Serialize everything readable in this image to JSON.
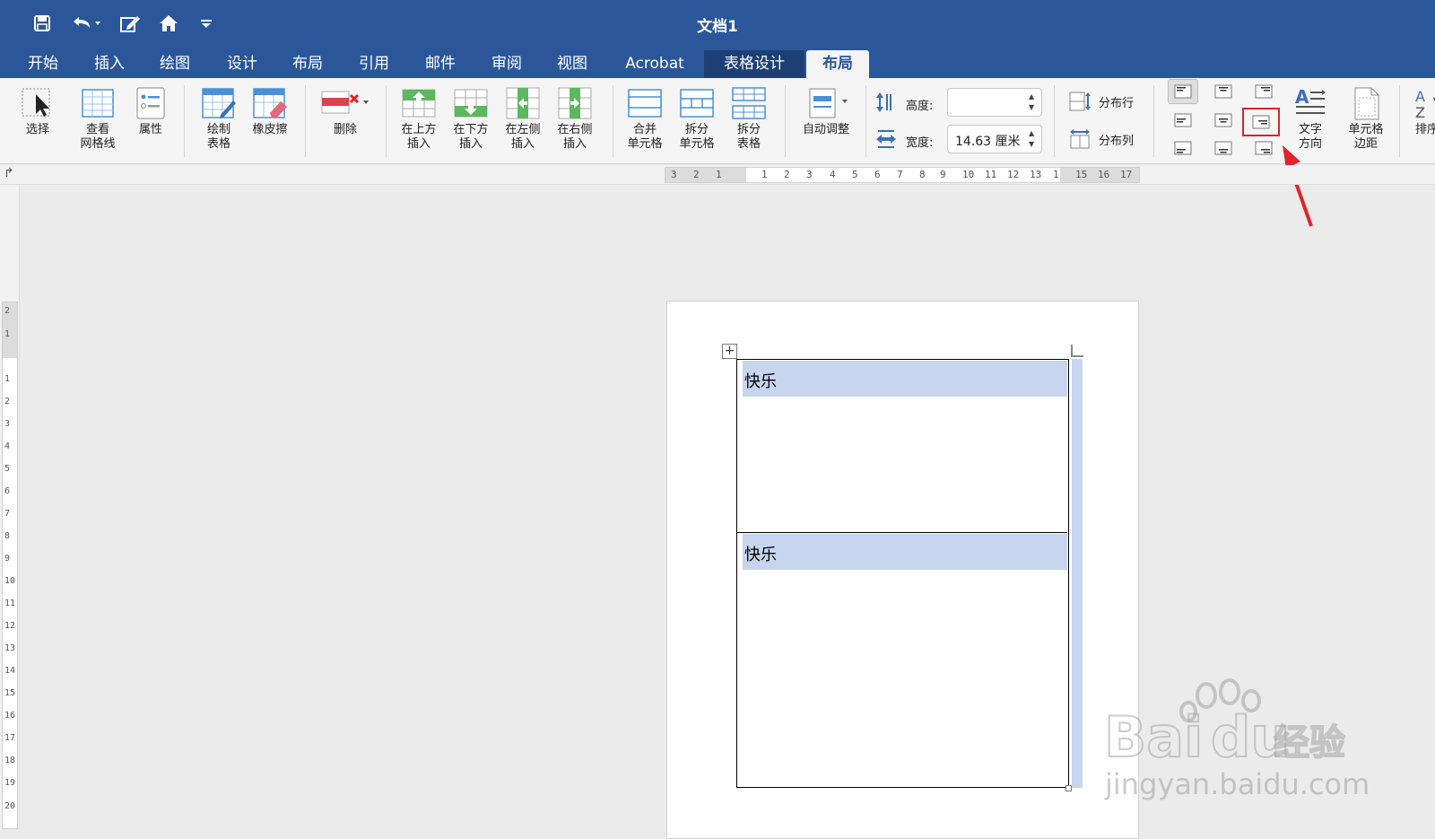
{
  "window": {
    "title": "文档1"
  },
  "quick_access": [
    "save-icon",
    "undo-icon",
    "edit-icon",
    "home-icon",
    "customize-icon"
  ],
  "tabs": [
    {
      "label": "开始"
    },
    {
      "label": "插入"
    },
    {
      "label": "绘图"
    },
    {
      "label": "设计"
    },
    {
      "label": "布局"
    },
    {
      "label": "引用"
    },
    {
      "label": "邮件"
    },
    {
      "label": "审阅"
    },
    {
      "label": "视图"
    },
    {
      "label": "Acrobat"
    },
    {
      "label": "表格设计"
    },
    {
      "label": "布局",
      "active": true
    }
  ],
  "ribbon": {
    "select": "选择",
    "view_gridlines": "查看\n网格线",
    "properties": "属性",
    "draw_table": "绘制\n表格",
    "eraser": "橡皮擦",
    "delete": "删除",
    "insert_above": "在上方\n插入",
    "insert_below": "在下方\n插入",
    "insert_left": "在左侧\n插入",
    "insert_right": "在右侧\n插入",
    "merge_cells": "合并\n单元格",
    "split_cells": "拆分\n单元格",
    "split_table": "拆分\n表格",
    "autofit": "自动调整",
    "height_label": "高度:",
    "height_value": "",
    "width_label": "宽度:",
    "width_value": "14.63 厘米",
    "distribute_rows": "分布行",
    "distribute_cols": "分布列",
    "text_direction": "文字\n方向",
    "cell_margins": "单元格\n边距",
    "sort": "排序"
  },
  "ruler": {
    "horizontal_ticks": [
      "3",
      "2",
      "1",
      "1",
      "2",
      "3",
      "4",
      "5",
      "6",
      "7",
      "8",
      "9",
      "10",
      "11",
      "12",
      "13",
      "1",
      "15",
      "16",
      "17"
    ],
    "vertical_ticks": [
      "2",
      "1",
      "1",
      "2",
      "3",
      "4",
      "5",
      "6",
      "7",
      "8",
      "9",
      "10",
      "11",
      "12",
      "13",
      "14",
      "15",
      "16",
      "17",
      "18",
      "19",
      "20"
    ]
  },
  "document": {
    "rows": [
      {
        "text": "快乐"
      },
      {
        "text": "快乐"
      }
    ]
  },
  "watermark": {
    "logo": "Bai du 经验",
    "url": "jingyan.baidu.com"
  },
  "colors": {
    "ribbon_blue": "#2b579a",
    "selection": "#c7d5ee",
    "annotation_red": "#d9242b"
  }
}
